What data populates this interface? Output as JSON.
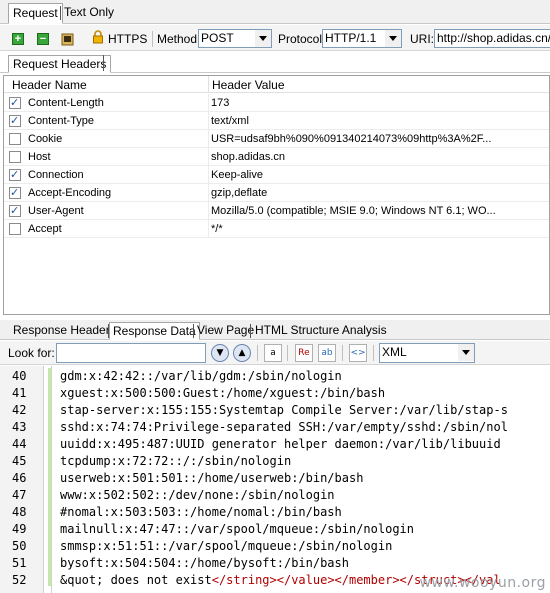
{
  "top_tabs": [
    {
      "label": "Request",
      "active": true
    },
    {
      "label": "Text Only",
      "active": false
    }
  ],
  "toolbar": {
    "https_label": "HTTPS",
    "method_label": "Method:",
    "method_value": "POST",
    "protocol_label": "Protocol:",
    "protocol_value": "HTTP/1.1",
    "uri_label": "URI:",
    "uri_value": "http://shop.adidas.cn/a"
  },
  "request_headers_tab": "Request Headers",
  "grid": {
    "col_name": "Header Name",
    "col_value": "Header Value",
    "rows": [
      {
        "checked": true,
        "name": "Content-Length",
        "value": "173"
      },
      {
        "checked": true,
        "name": "Content-Type",
        "value": "text/xml"
      },
      {
        "checked": false,
        "name": "Cookie",
        "value": "USR=udsaf9bh%090%091340214073%09http%3A%2F..."
      },
      {
        "checked": false,
        "name": "Host",
        "value": "shop.adidas.cn"
      },
      {
        "checked": true,
        "name": "Connection",
        "value": "Keep-alive"
      },
      {
        "checked": true,
        "name": "Accept-Encoding",
        "value": "gzip,deflate"
      },
      {
        "checked": true,
        "name": "User-Agent",
        "value": "Mozilla/5.0 (compatible; MSIE 9.0; Windows NT 6.1; WO..."
      },
      {
        "checked": false,
        "name": "Accept",
        "value": "*/*"
      }
    ]
  },
  "response_tabs": [
    {
      "label": "Response Headers",
      "active": false
    },
    {
      "label": "Response Data",
      "active": true
    },
    {
      "label": "View Page",
      "active": false
    },
    {
      "label": "HTML Structure Analysis",
      "active": false
    }
  ],
  "findbar": {
    "look_for_label": "Look for:",
    "look_for_value": "",
    "format_value": "XML"
  },
  "code_lines": [
    {
      "no": "40",
      "text": "gdm:x:42:42::/var/lib/gdm:/sbin/nologin"
    },
    {
      "no": "41",
      "text": "xguest:x:500:500:Guest:/home/xguest:/bin/bash"
    },
    {
      "no": "42",
      "text": "stap-server:x:155:155:Systemtap Compile Server:/var/lib/stap-s"
    },
    {
      "no": "43",
      "text": "sshd:x:74:74:Privilege-separated SSH:/var/empty/sshd:/sbin/nol"
    },
    {
      "no": "44",
      "text": "uuidd:x:495:487:UUID generator helper daemon:/var/lib/libuuid"
    },
    {
      "no": "45",
      "text": "tcpdump:x:72:72::/:/sbin/nologin"
    },
    {
      "no": "46",
      "text": "userweb:x:501:501::/home/userweb:/bin/bash"
    },
    {
      "no": "47",
      "text": "www:x:502:502::/dev/none:/sbin/nologin"
    },
    {
      "no": "48",
      "text": "#nomal:x:503:503::/home/nomal:/bin/bash"
    },
    {
      "no": "49",
      "text": "mailnull:x:47:47::/var/spool/mqueue:/sbin/nologin"
    },
    {
      "no": "50",
      "text": "smmsp:x:51:51::/var/spool/mqueue:/sbin/nologin"
    },
    {
      "no": "51",
      "text": "bysoft:x:504:504::/home/bysoft:/bin/bash"
    }
  ],
  "last_line": {
    "no": "52",
    "text_plain": "&quot; does not exist",
    "text_tags": "</string></value></member></struct></val"
  },
  "watermark": "www.wooyun.org"
}
